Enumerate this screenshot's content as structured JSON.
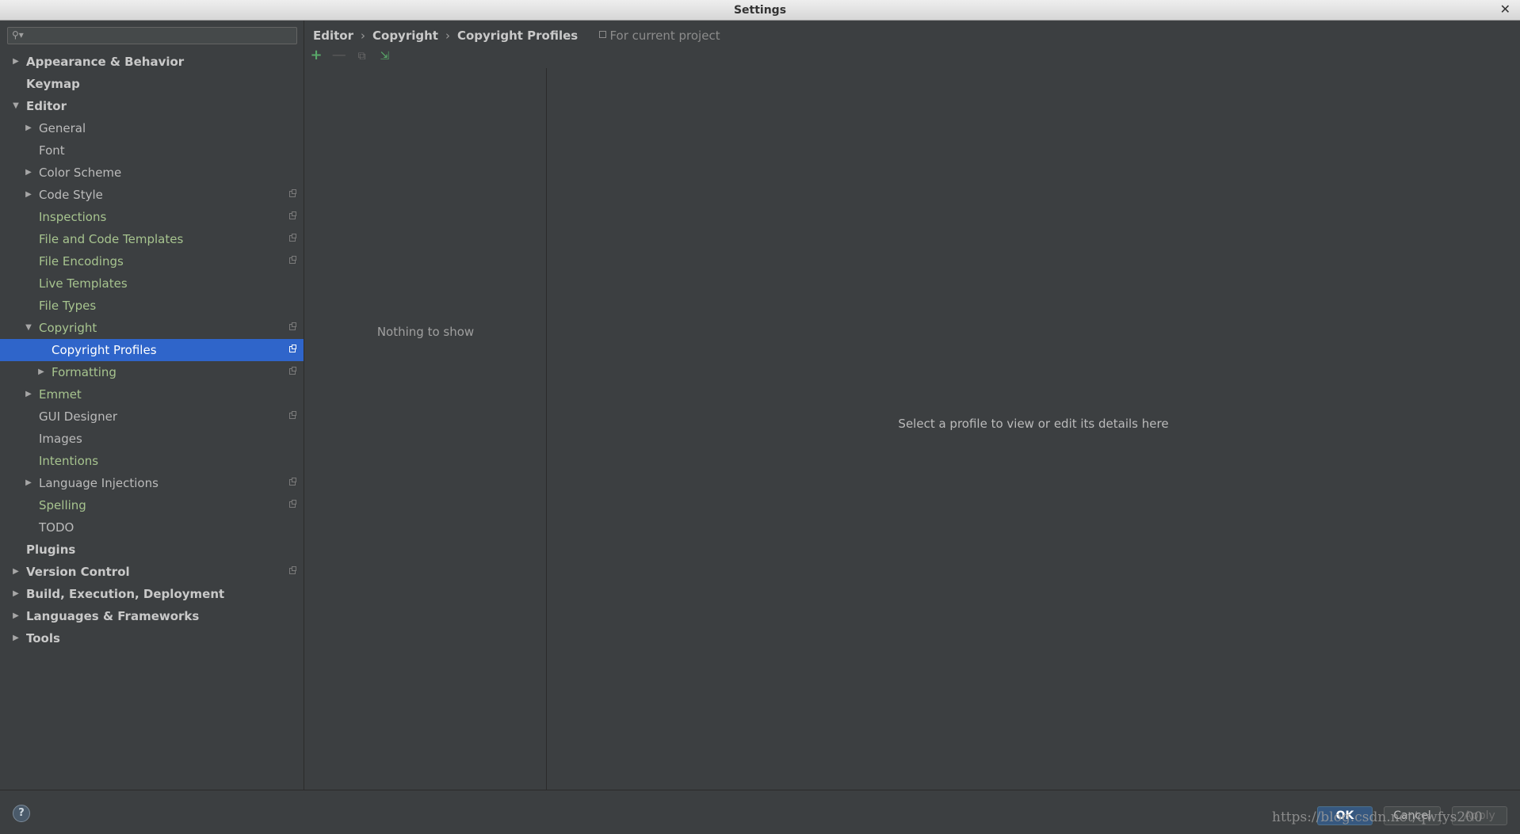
{
  "window": {
    "title": "Settings"
  },
  "search": {
    "placeholder": ""
  },
  "tree": [
    {
      "label": "Appearance & Behavior",
      "level": 0,
      "arrow": "right",
      "bold": true
    },
    {
      "label": "Keymap",
      "level": 0,
      "arrow": "",
      "bold": true
    },
    {
      "label": "Editor",
      "level": 0,
      "arrow": "down",
      "bold": true
    },
    {
      "label": "General",
      "level": 1,
      "arrow": "right"
    },
    {
      "label": "Font",
      "level": 1,
      "arrow": ""
    },
    {
      "label": "Color Scheme",
      "level": 1,
      "arrow": "right"
    },
    {
      "label": "Code Style",
      "level": 1,
      "arrow": "right",
      "project": true
    },
    {
      "label": "Inspections",
      "level": 1,
      "arrow": "",
      "project": true,
      "teal": true
    },
    {
      "label": "File and Code Templates",
      "level": 1,
      "arrow": "",
      "project": true,
      "teal": true
    },
    {
      "label": "File Encodings",
      "level": 1,
      "arrow": "",
      "project": true,
      "teal": true
    },
    {
      "label": "Live Templates",
      "level": 1,
      "arrow": "",
      "teal": true
    },
    {
      "label": "File Types",
      "level": 1,
      "arrow": "",
      "teal": true
    },
    {
      "label": "Copyright",
      "level": 1,
      "arrow": "down",
      "project": true,
      "teal": true
    },
    {
      "label": "Copyright Profiles",
      "level": 2,
      "arrow": "",
      "project": true,
      "selected": true
    },
    {
      "label": "Formatting",
      "level": 2,
      "arrow": "right",
      "project": true,
      "teal": true
    },
    {
      "label": "Emmet",
      "level": 1,
      "arrow": "right",
      "teal": true
    },
    {
      "label": "GUI Designer",
      "level": 1,
      "arrow": "",
      "project": true
    },
    {
      "label": "Images",
      "level": 1,
      "arrow": ""
    },
    {
      "label": "Intentions",
      "level": 1,
      "arrow": "",
      "teal": true
    },
    {
      "label": "Language Injections",
      "level": 1,
      "arrow": "right",
      "project": true
    },
    {
      "label": "Spelling",
      "level": 1,
      "arrow": "",
      "project": true,
      "teal": true
    },
    {
      "label": "TODO",
      "level": 1,
      "arrow": ""
    },
    {
      "label": "Plugins",
      "level": 0,
      "arrow": "",
      "bold": true
    },
    {
      "label": "Version Control",
      "level": 0,
      "arrow": "right",
      "bold": true,
      "project": true
    },
    {
      "label": "Build, Execution, Deployment",
      "level": 0,
      "arrow": "right",
      "bold": true
    },
    {
      "label": "Languages & Frameworks",
      "level": 0,
      "arrow": "right",
      "bold": true
    },
    {
      "label": "Tools",
      "level": 0,
      "arrow": "right",
      "bold": true
    }
  ],
  "breadcrumb": {
    "items": [
      "Editor",
      "Copyright",
      "Copyright Profiles"
    ],
    "separator": "›",
    "scope": "For current project"
  },
  "toolbar": {
    "add": "+",
    "remove": "—",
    "copy": "⧉",
    "import": "⇲"
  },
  "list": {
    "empty_text": "Nothing to show"
  },
  "details": {
    "empty_text": "Select a profile to view or edit its details here"
  },
  "footer": {
    "help": "?",
    "ok": "OK",
    "cancel": "Cancel",
    "apply": "Apply"
  },
  "watermark": "https://blog.csdn.net/qwfys200",
  "colors": {
    "selection": "#2f65ca",
    "background": "#3c3f41",
    "teal_text": "#a7c48f",
    "ok_button": "#365880"
  }
}
